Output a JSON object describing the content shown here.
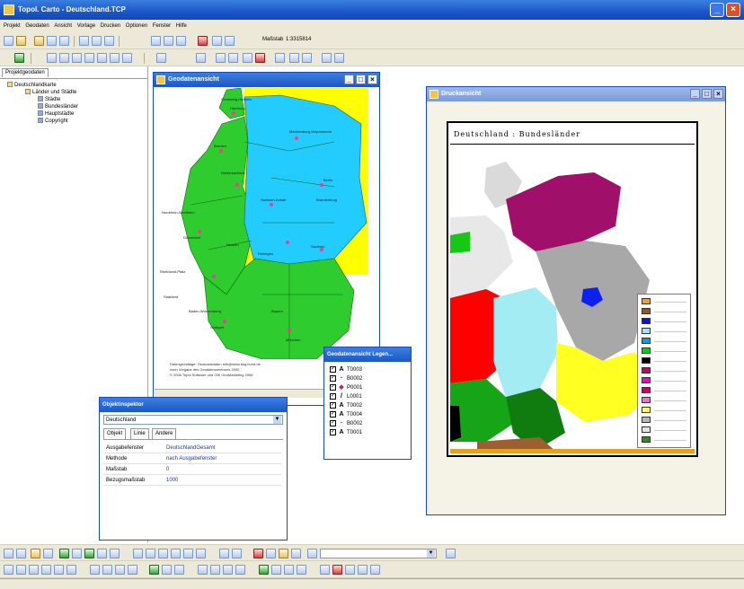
{
  "app": {
    "title": "Topol. Carto - Deutschland.TCP"
  },
  "menu": [
    "Projekt",
    "Geodaten",
    "Ansicht",
    "Vorlage",
    "Drucken",
    "Optionen",
    "Fenster",
    "Hilfe"
  ],
  "toolbar": {
    "scale_label": "Maßstab",
    "scale_value": "1:3315814"
  },
  "project_panel": {
    "tab": "Projektgeodaten",
    "tree": [
      {
        "label": "Deutschlandkarte",
        "level": 0
      },
      {
        "label": "Länder und Städte",
        "level": 1
      },
      {
        "label": "Städte",
        "level": 2
      },
      {
        "label": "Bundesländer",
        "level": 2
      },
      {
        "label": "Hauptstädte",
        "level": 2
      },
      {
        "label": "Copyright",
        "level": 2
      }
    ]
  },
  "geo_window": {
    "title": "Geodatenansicht",
    "copyright_lines": [
      "Datengrundlage: Geobasisdaten info@www.bkg.bund.de",
      "nach Vorgabe des Geodatenzentrums 2000",
      "© 2006 Topol Software und GfK GeoMarketing 2006"
    ]
  },
  "print_window": {
    "title": "Druckansicht",
    "paper_title": "Deutschland  :  Bundesländer",
    "legend_colors": [
      "#f4a020",
      "#8b5a2b",
      "#1010ee",
      "#a4e4ef",
      "#00a0e8",
      "#16c716",
      "#000000",
      "#b01060",
      "#ff00cc",
      "#cc0060",
      "#ff66dd",
      "#fbfb66",
      "#b8b8b8",
      "#e4e4e4",
      "#2a8c2a"
    ]
  },
  "legend_window": {
    "title": "Geodatenansicht Legen...",
    "rows": [
      {
        "symbol": "A",
        "label": "T0003"
      },
      {
        "symbol": "·",
        "label": "B0002"
      },
      {
        "symbol": "◆",
        "label": "P0001"
      },
      {
        "symbol": "/",
        "label": "L0001"
      },
      {
        "symbol": "A",
        "label": "T0002"
      },
      {
        "symbol": "A",
        "label": "T0004"
      },
      {
        "symbol": "·",
        "label": "B0002"
      },
      {
        "symbol": "A",
        "label": "T0001"
      }
    ]
  },
  "inspector": {
    "title": "Objektinspektor",
    "selected": "Deutschland",
    "tabs": [
      "Objekt",
      "Linie",
      "Andere"
    ],
    "rows": [
      {
        "key": "Ausgabefenster",
        "value": "DeutschlandGesamt"
      },
      {
        "key": "Methode",
        "value": "nach Ausgabefenster"
      },
      {
        "key": "Maßstab",
        "value": "0"
      },
      {
        "key": "Bezugsmaßstab",
        "value": "1000"
      }
    ]
  },
  "state_labels": [
    {
      "name": "Hamburg"
    },
    {
      "name": "Schleswig-Holstein"
    },
    {
      "name": "Mecklenburg-Vorpommern"
    },
    {
      "name": "Bremen"
    },
    {
      "name": "Niedersachsen"
    },
    {
      "name": "Berlin"
    },
    {
      "name": "Brandenburg"
    },
    {
      "name": "Sachsen-Anhalt"
    },
    {
      "name": "Nordrhein-Westfalen"
    },
    {
      "name": "Düsseldorf"
    },
    {
      "name": "Hessen"
    },
    {
      "name": "Thüringen"
    },
    {
      "name": "Sachsen"
    },
    {
      "name": "Rheinland-Pfalz"
    },
    {
      "name": "Saarland"
    },
    {
      "name": "Baden-Württemberg"
    },
    {
      "name": "Stuttgart"
    },
    {
      "name": "Bayern"
    },
    {
      "name": "München"
    }
  ]
}
